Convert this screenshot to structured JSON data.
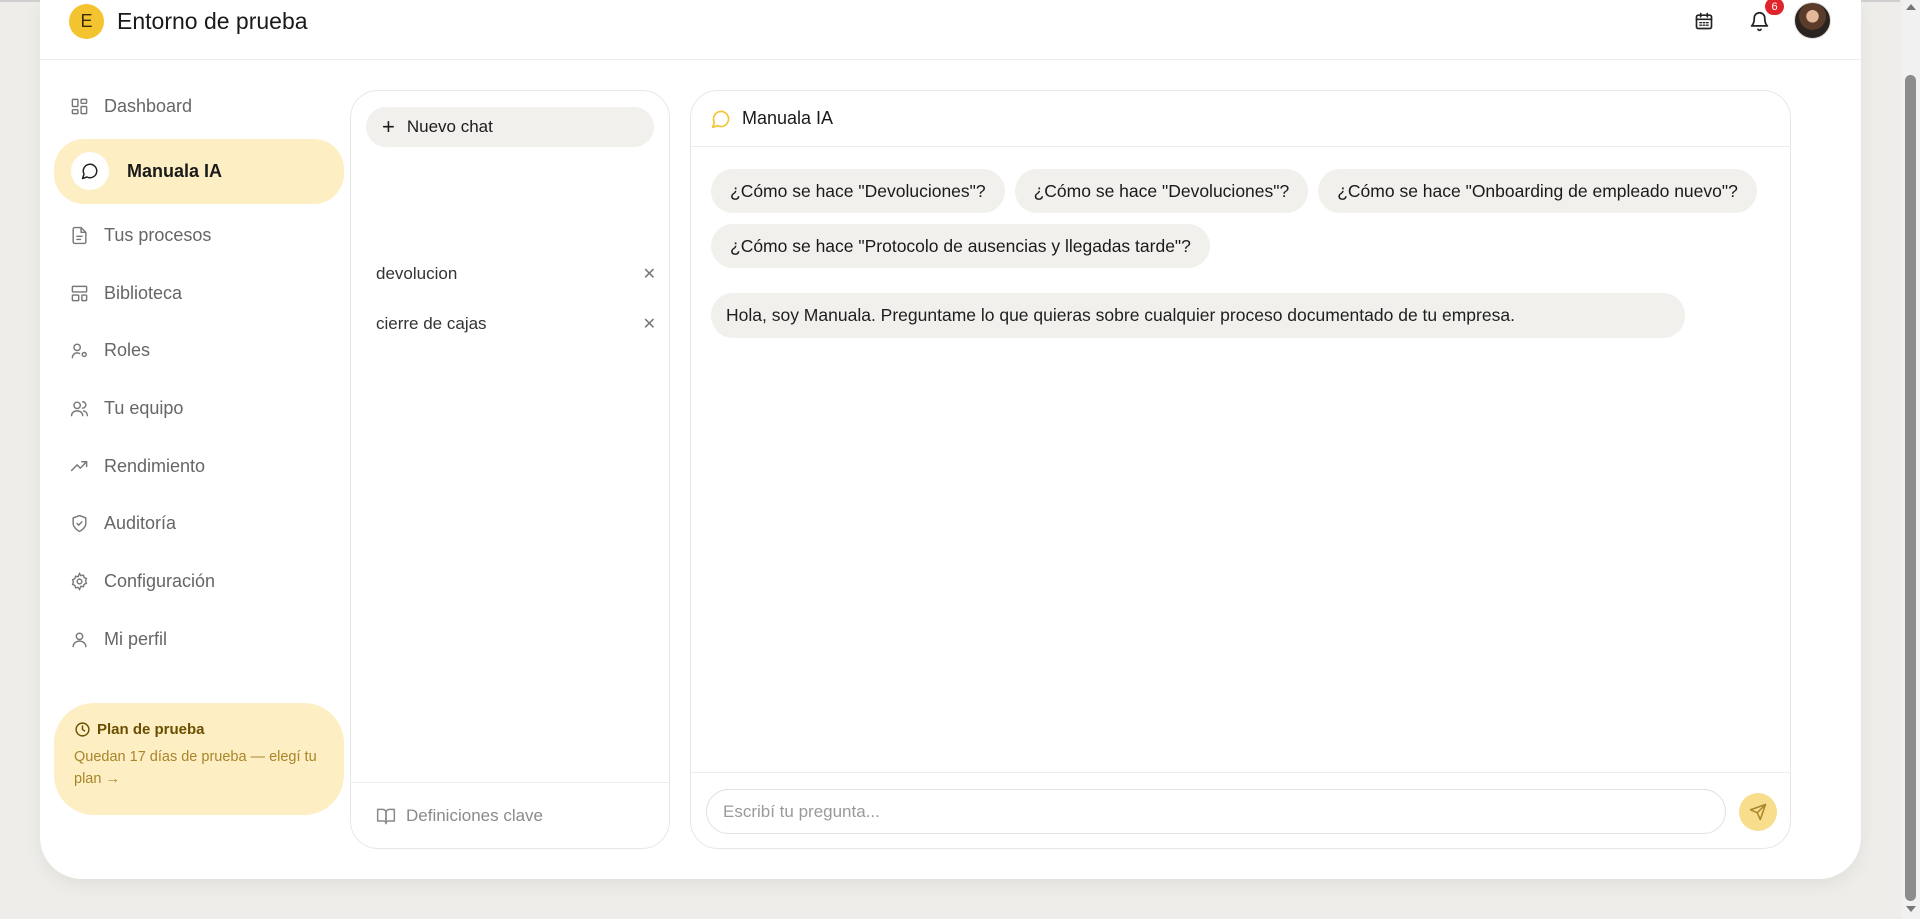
{
  "header": {
    "org_initial": "E",
    "org_name": "Entorno de prueba",
    "notifications_count": "6",
    "icons": [
      "calendar-icon",
      "bell-icon",
      "avatar"
    ]
  },
  "sidebar": {
    "items": [
      {
        "label": "Dashboard",
        "icon": "dashboard-icon"
      },
      {
        "label": "Manuala IA",
        "icon": "chat-bubble-icon",
        "active": true
      },
      {
        "label": "Tus procesos",
        "icon": "document-icon"
      },
      {
        "label": "Biblioteca",
        "icon": "library-icon"
      },
      {
        "label": "Roles",
        "icon": "user-gear-icon"
      },
      {
        "label": "Tu equipo",
        "icon": "users-icon"
      },
      {
        "label": "Rendimiento",
        "icon": "trending-up-icon"
      },
      {
        "label": "Auditoría",
        "icon": "shield-check-icon"
      },
      {
        "label": "Configuración",
        "icon": "gear-icon"
      },
      {
        "label": "Mi perfil",
        "icon": "user-icon"
      }
    ],
    "plan": {
      "title": "Plan de prueba",
      "text": "Quedan 17 días de prueba — elegí tu plan →"
    }
  },
  "chatlist": {
    "new_chat_label": "Nuevo chat",
    "chats": [
      {
        "title": "devolucion"
      },
      {
        "title": "cierre de cajas"
      }
    ],
    "footer_label": "Definiciones clave"
  },
  "chat": {
    "title": "Manuala IA",
    "suggestions": [
      "¿Cómo se hace \"Devoluciones\"?",
      "¿Cómo se hace \"Devoluciones\"?",
      "¿Cómo se hace \"Onboarding de empleado nuevo\"?",
      "¿Cómo se hace \"Protocolo de ausencias y llegadas tarde\"?"
    ],
    "bot_message": "Hola, soy Manuala. Preguntame lo que quieras sobre cualquier proceso documentado de tu empresa.",
    "input_placeholder": "Escribí tu pregunta..."
  },
  "colors": {
    "accent": "#f4c430",
    "active_bg": "#fdeec4",
    "chip_bg": "#f1f0ec",
    "badge_red": "#e0242b",
    "send_bg": "#f8dd8c"
  }
}
